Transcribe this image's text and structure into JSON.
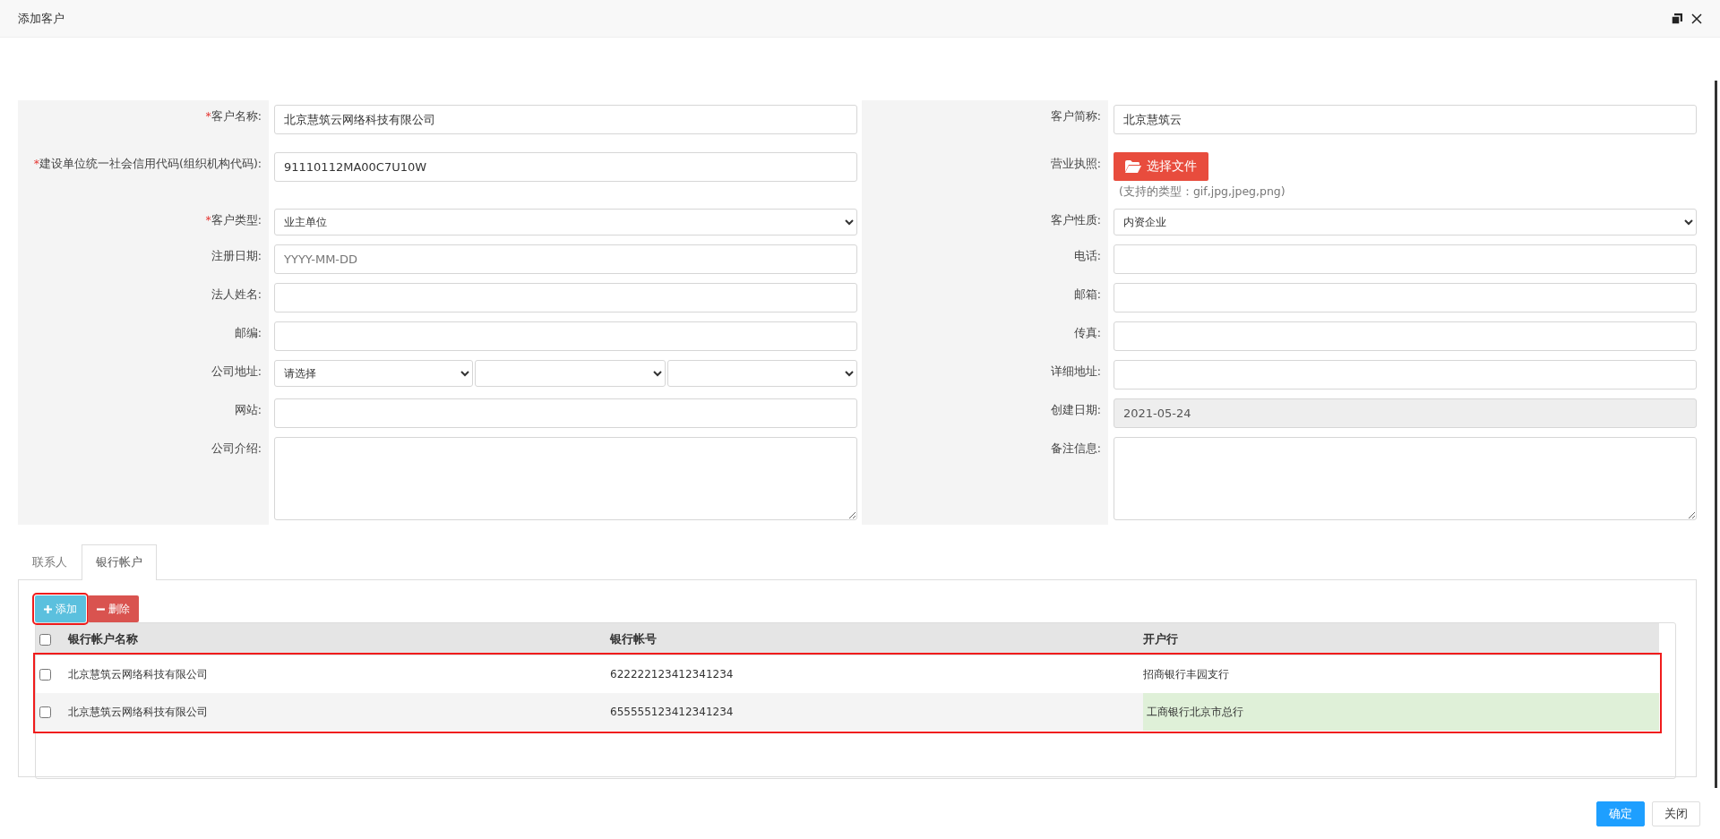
{
  "window": {
    "title": "添加客户"
  },
  "form": {
    "rows": [
      {
        "left": {
          "label": "客户名称:",
          "marker": "*",
          "kind": "text",
          "value": "北京慧筑云网络科技有限公司"
        },
        "right": {
          "label": "客户简称:",
          "kind": "text",
          "value": "北京慧筑云"
        }
      },
      {
        "left": {
          "label": "建设单位统一社会信用代码(组织机构代码):",
          "marker": "*",
          "kind": "text",
          "value": "91110112MA00C7U10W"
        },
        "right": {
          "label": "营业执照:",
          "kind": "file",
          "button": "选择文件",
          "hint": "(支持的类型：gif,jpg,jpeg,png)"
        }
      },
      {
        "left": {
          "label": "客户类型:",
          "marker": "*",
          "kind": "select",
          "value": "业主单位"
        },
        "right": {
          "label": "客户性质:",
          "kind": "select",
          "value": "内资企业"
        }
      },
      {
        "left": {
          "label": "注册日期:",
          "kind": "text",
          "placeholder": "YYYY-MM-DD"
        },
        "right": {
          "label": "电话:",
          "kind": "text"
        }
      },
      {
        "left": {
          "label": "法人姓名:",
          "kind": "text"
        },
        "right": {
          "label": "邮箱:",
          "kind": "text"
        }
      },
      {
        "left": {
          "label": "邮编:",
          "kind": "text"
        },
        "right": {
          "label": "传真:",
          "kind": "text"
        }
      },
      {
        "left": {
          "label": "公司地址:",
          "kind": "address",
          "value": "请选择"
        },
        "right": {
          "label": "详细地址:",
          "kind": "text"
        }
      },
      {
        "left": {
          "label": "网站:",
          "kind": "text"
        },
        "right": {
          "label": "创建日期:",
          "kind": "readonly",
          "value": "2021-05-24"
        }
      },
      {
        "left": {
          "label": "公司介绍:",
          "kind": "textarea"
        },
        "right": {
          "label": "备注信息:",
          "kind": "textarea"
        }
      }
    ]
  },
  "tabs": [
    {
      "label": "联系人",
      "selected": false
    },
    {
      "label": "银行帐户",
      "selected": true
    }
  ],
  "toolbar": [
    {
      "label": "添加",
      "kind": "add",
      "outlined": true
    },
    {
      "label": "删除",
      "kind": "delete",
      "outlined": false
    }
  ],
  "table": {
    "columns": [
      "银行帐户名称",
      "银行帐号",
      "开户行"
    ],
    "header_checked": false,
    "rows_outlined": true,
    "rows": [
      {
        "checked": false,
        "name": "北京慧筑云网络科技有限公司",
        "account": "622222123412341234",
        "bank": "招商银行丰园支行",
        "bank_highlighted": false
      },
      {
        "checked": false,
        "name": "北京慧筑云网络科技有限公司",
        "account": "655555123412341234",
        "bank": "工商银行北京市总行",
        "bank_highlighted": true
      }
    ]
  },
  "footer": [
    {
      "label": "确定",
      "kind": "primary"
    },
    {
      "label": "关闭",
      "kind": "default"
    }
  ]
}
